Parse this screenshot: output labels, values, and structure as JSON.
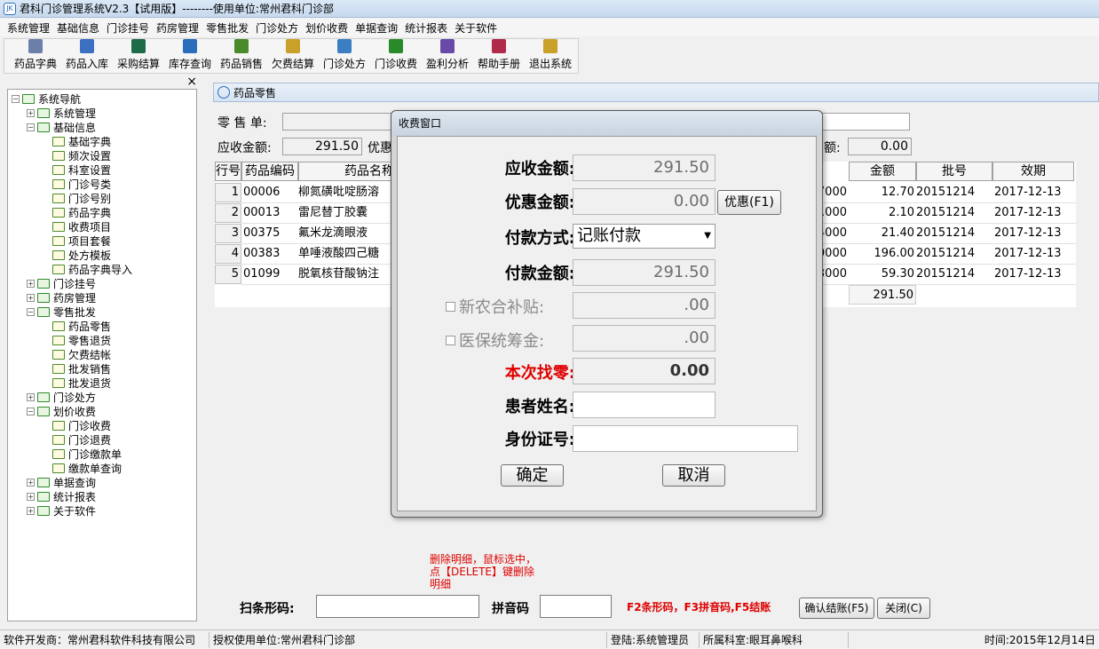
{
  "window": {
    "title": "君科门诊管理系统V2.3【试用版】--------使用单位:常州君科门诊部"
  },
  "menu": [
    "系统管理",
    "基础信息",
    "门诊挂号",
    "药房管理",
    "零售批发",
    "门诊处方",
    "划价收费",
    "单据查询",
    "统计报表",
    "关于软件"
  ],
  "toolbar": [
    {
      "label": "药品字典",
      "icon": "pill-icon",
      "color": "#6b7fa8"
    },
    {
      "label": "药品入库",
      "icon": "calendar-icon",
      "color": "#3b6fc2"
    },
    {
      "label": "采购结算",
      "icon": "ledger-icon",
      "color": "#1e6b4a"
    },
    {
      "label": "库存查询",
      "icon": "formula-icon",
      "color": "#2a6ebb"
    },
    {
      "label": "药品销售",
      "icon": "bottle-icon",
      "color": "#4a8a2a"
    },
    {
      "label": "欠费结算",
      "icon": "coins-icon",
      "color": "#c8a02a"
    },
    {
      "label": "门诊处方",
      "icon": "prescription-icon",
      "color": "#3b7fc2"
    },
    {
      "label": "门诊收费",
      "icon": "money-bag-icon",
      "color": "#2a8a2a"
    },
    {
      "label": "盈利分析",
      "icon": "bar-chart-icon",
      "color": "#6a4aa8"
    },
    {
      "label": "帮助手册",
      "icon": "book-icon",
      "color": "#b02a4a"
    },
    {
      "label": "退出系统",
      "icon": "exit-icon",
      "color": "#c8a02a"
    }
  ],
  "nav": {
    "close": "×",
    "tree": [
      {
        "label": "系统导航",
        "level": 0,
        "exp": "−",
        "leaf": false
      },
      {
        "label": "系统管理",
        "level": 1,
        "exp": "+",
        "leaf": false
      },
      {
        "label": "基础信息",
        "level": 1,
        "exp": "−",
        "leaf": false
      },
      {
        "label": "基础字典",
        "level": 2,
        "exp": "",
        "leaf": true
      },
      {
        "label": "频次设置",
        "level": 2,
        "exp": "",
        "leaf": true
      },
      {
        "label": "科室设置",
        "level": 2,
        "exp": "",
        "leaf": true
      },
      {
        "label": "门诊号类",
        "level": 2,
        "exp": "",
        "leaf": true
      },
      {
        "label": "门诊号别",
        "level": 2,
        "exp": "",
        "leaf": true
      },
      {
        "label": "药品字典",
        "level": 2,
        "exp": "",
        "leaf": true
      },
      {
        "label": "收费项目",
        "level": 2,
        "exp": "",
        "leaf": true
      },
      {
        "label": "项目套餐",
        "level": 2,
        "exp": "",
        "leaf": true
      },
      {
        "label": "处方模板",
        "level": 2,
        "exp": "",
        "leaf": true
      },
      {
        "label": "药品字典导入",
        "level": 2,
        "exp": "",
        "leaf": true
      },
      {
        "label": "门诊挂号",
        "level": 1,
        "exp": "+",
        "leaf": false
      },
      {
        "label": "药房管理",
        "level": 1,
        "exp": "+",
        "leaf": false
      },
      {
        "label": "零售批发",
        "level": 1,
        "exp": "−",
        "leaf": false
      },
      {
        "label": "药品零售",
        "level": 2,
        "exp": "",
        "leaf": true
      },
      {
        "label": "零售退货",
        "level": 2,
        "exp": "",
        "leaf": true
      },
      {
        "label": "欠费结帐",
        "level": 2,
        "exp": "",
        "leaf": true
      },
      {
        "label": "批发销售",
        "level": 2,
        "exp": "",
        "leaf": true
      },
      {
        "label": "批发退货",
        "level": 2,
        "exp": "",
        "leaf": true
      },
      {
        "label": "门诊处方",
        "level": 1,
        "exp": "+",
        "leaf": false
      },
      {
        "label": "划价收费",
        "level": 1,
        "exp": "−",
        "leaf": false
      },
      {
        "label": "门诊收费",
        "level": 2,
        "exp": "",
        "leaf": true
      },
      {
        "label": "门诊退费",
        "level": 2,
        "exp": "",
        "leaf": true
      },
      {
        "label": "门诊缴款单",
        "level": 2,
        "exp": "",
        "leaf": true
      },
      {
        "label": "缴款单查询",
        "level": 2,
        "exp": "",
        "leaf": true
      },
      {
        "label": "单据查询",
        "level": 1,
        "exp": "+",
        "leaf": false
      },
      {
        "label": "统计报表",
        "level": 1,
        "exp": "+",
        "leaf": false
      },
      {
        "label": "关于软件",
        "level": 1,
        "exp": "+",
        "leaf": false
      }
    ]
  },
  "doc": {
    "tab_title": "药品零售",
    "form": {
      "sale_label": "零 售 单:",
      "receivable_label": "应收金额:",
      "receivable_value": "291.50",
      "discount_label_partial": "优惠",
      "right_label_partial": "额:",
      "right_value": "0.00"
    },
    "grid": {
      "headers": [
        "行号",
        "药品编码",
        "药品名称",
        "金额",
        "批号",
        "效期"
      ],
      "rows": [
        {
          "no": "1",
          "code": "00006",
          "name": "柳氮磺吡啶肠溶",
          "price": "7000",
          "amount": "12.70",
          "batch": "20151214",
          "expiry": "2017-12-13"
        },
        {
          "no": "2",
          "code": "00013",
          "name": "雷尼替丁胶囊",
          "price": ".000",
          "amount": "2.10",
          "batch": "20151214",
          "expiry": "2017-12-13"
        },
        {
          "no": "3",
          "code": "00375",
          "name": "氟米龙滴眼液",
          "price": "4000",
          "amount": "21.40",
          "batch": "20151214",
          "expiry": "2017-12-13"
        },
        {
          "no": "4",
          "code": "00383",
          "name": "单唾液酸四己糖",
          "price": "0000",
          "amount": "196.00",
          "batch": "20151214",
          "expiry": "2017-12-13"
        },
        {
          "no": "5",
          "code": "01099",
          "name": "脱氧核苷酸钠注",
          "price": "3000",
          "amount": "59.30",
          "batch": "20151214",
          "expiry": "2017-12-13"
        }
      ],
      "total": "291.50"
    },
    "note": "删除明细，鼠标选中，点【DELETE】键删除明细",
    "bottom": {
      "barcode_label": "扫条形码:",
      "pinyin_label": "拼音码",
      "hint": "F2条形码，F3拼音码,F5结账",
      "confirm_button": "确认结账(F5)",
      "close_button": "关闭(C)"
    }
  },
  "dialog": {
    "title": "收费窗口",
    "receivable_label": "应收金额:",
    "receivable_value": "291.50",
    "discount_label": "优惠金额:",
    "discount_value": "0.00",
    "discount_button": "优惠(F1)",
    "payment_method_label": "付款方式:",
    "payment_method_value": "记账付款",
    "payment_amount_label": "付款金额:",
    "payment_amount_value": "291.50",
    "ncms_label": "新农合补贴:",
    "ncms_value": ".00",
    "insurance_label": "医保统筹金:",
    "insurance_value": ".00",
    "change_label": "本次找零:",
    "change_value": "0.00",
    "patient_name_label": "患者姓名:",
    "patient_name_value": "",
    "id_label": "身份证号:",
    "id_value": "",
    "ok_button": "确定",
    "cancel_button": "取消"
  },
  "status": {
    "developer": "软件开发商：常州君科软件科技有限公司",
    "licensee": "授权使用单位:常州君科门诊部",
    "login": "登陆:系统管理员",
    "department": "所属科室:眼耳鼻喉科",
    "time": "时间:2015年12月14日"
  }
}
